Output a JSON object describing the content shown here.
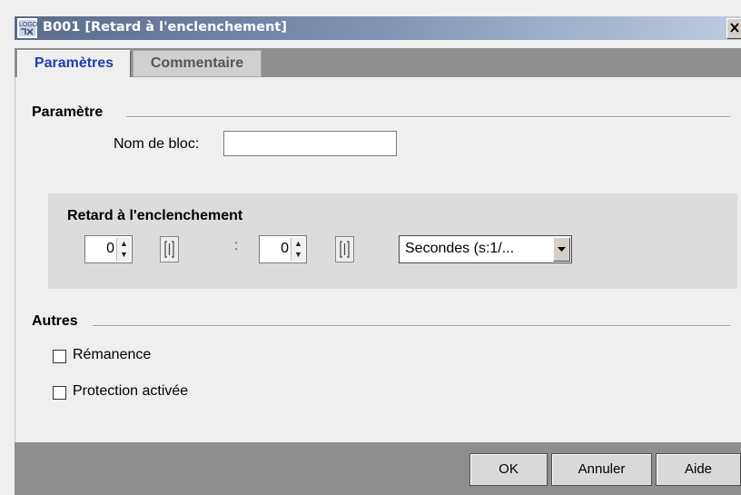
{
  "window": {
    "title": "B001 [Retard à l'enclenchement]",
    "icon": "logo-icon",
    "close_label": "x"
  },
  "tabs": [
    {
      "label": "Paramètres",
      "active": true
    },
    {
      "label": "Commentaire",
      "active": false
    }
  ],
  "parametre": {
    "section_title": "Paramètre",
    "block_name_label": "Nom de bloc:",
    "block_name_value": ""
  },
  "delay_group": {
    "title": "Retard à l'enclenchement",
    "value1": "0",
    "separator": ":",
    "value2": "0",
    "unit_selected": "Secondes (s:1/..."
  },
  "autres": {
    "section_title": "Autres",
    "remanence_label": "Rémanence",
    "remanence_checked": false,
    "protection_label": "Protection activée",
    "protection_checked": false
  },
  "footer": {
    "ok_label": "OK",
    "cancel_label": "Annuler",
    "help_label": "Aide"
  },
  "colors": {
    "active_tab_text": "#1d3fb0",
    "titlebar_start": "#5b6b8c",
    "footer_bg": "#8e8e8e"
  }
}
